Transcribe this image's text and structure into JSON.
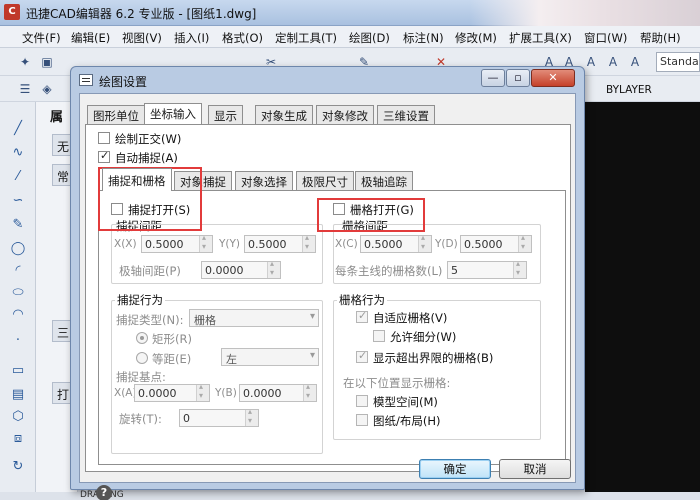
{
  "app": {
    "title": "迅捷CAD编辑器 6.2 专业版  - [图纸1.dwg]",
    "menu": [
      "文件(F)",
      "编辑(E)",
      "视图(V)",
      "插入(I)",
      "格式(O)",
      "定制工具(T)",
      "绘图(D)",
      "标注(N)",
      "修改(M)",
      "扩展工具(X)",
      "窗口(W)",
      "帮助(H)"
    ],
    "style_combo": "Standa",
    "layer_combo": "BYLAYER",
    "properties_title": "属",
    "prop_none": "无",
    "prop_tab_1": "常",
    "prop_tab_2": "三",
    "prop_tab_3": "打",
    "status_text": "DRAWING"
  },
  "dialog": {
    "title": "绘图设置",
    "buttons": {
      "minimize": "—",
      "restore": "▫",
      "close": "✕"
    },
    "tabs": [
      "图形单位",
      "坐标输入",
      "显示",
      "对象生成",
      "对象修改",
      "三维设置"
    ],
    "active_tab": "坐标输入",
    "ortho_label": "绘制正交(W)",
    "ortho_checked": false,
    "autosnap_label": "自动捕捉(A)",
    "autosnap_checked": true,
    "subtabs": [
      "捕捉和栅格",
      "对象捕捉",
      "对象选择",
      "极限尺寸",
      "极轴追踪"
    ],
    "active_subtab": "捕捉和栅格",
    "snap": {
      "on_label": "捕捉打开(S)",
      "on_checked": false,
      "spacing_title": "捕捉间距",
      "x_label": "X(X)",
      "x_value": "0.5000",
      "y_label": "Y(Y)",
      "y_value": "0.5000",
      "polar_label": "极轴间距(P)",
      "polar_value": "0.0000"
    },
    "grid": {
      "on_label": "栅格打开(G)",
      "on_checked": false,
      "spacing_title": "栅格间距",
      "x_label": "X(C)",
      "x_value": "0.5000",
      "y_label": "Y(D)",
      "y_value": "0.5000",
      "major_label": "每条主线的栅格数(L)",
      "major_value": "5"
    },
    "snap_behavior": {
      "title": "捕捉行为",
      "type_label": "捕捉类型(N):",
      "type_value": "栅格",
      "rect_label": "矩形(R)",
      "iso_label": "等距(E)",
      "iso_value": "左",
      "base_label": "捕捉基点:",
      "base_x_label": "X(A)",
      "base_x_value": "0.0000",
      "base_y_label": "Y(B)",
      "base_y_value": "0.0000",
      "rotation_label": "旋转(T):",
      "rotation_value": "0"
    },
    "grid_behavior": {
      "title": "栅格行为",
      "adaptive_label": "自适应栅格(V)",
      "adaptive_checked": true,
      "subdivide_label": "允许细分(W)",
      "subdivide_checked": false,
      "beyond_label": "显示超出界限的栅格(B)",
      "beyond_checked": true,
      "show_at_label": "在以下位置显示栅格:",
      "model_label": "模型空间(M)",
      "model_checked": false,
      "layout_label": "图纸/布局(H)",
      "layout_checked": false
    },
    "ok_label": "确定",
    "cancel_label": "取消"
  },
  "colors": {
    "highlight": "#e23b3b",
    "default_button": "#3c7fb1"
  }
}
